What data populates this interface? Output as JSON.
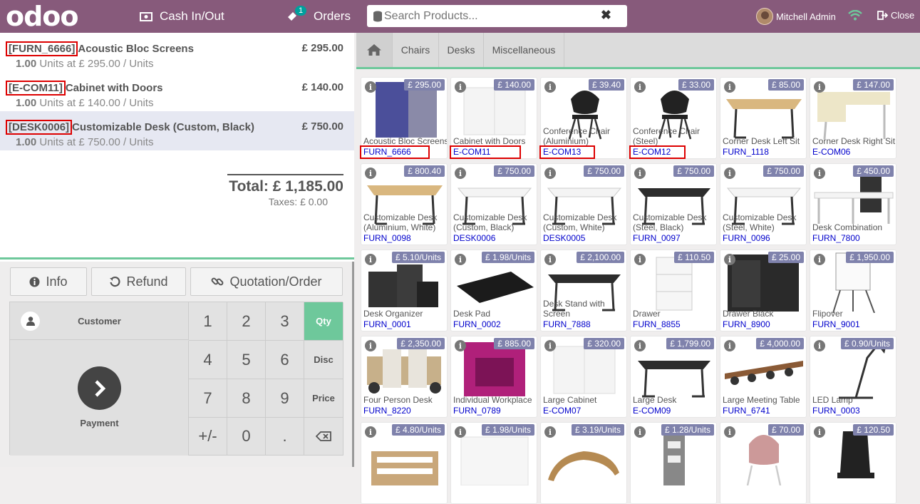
{
  "header": {
    "logo": "odoo",
    "cash_label": "Cash In/Out",
    "orders_label": "Orders",
    "orders_badge": "1",
    "search_placeholder": "Search Products...",
    "user_name": "Mitchell Admin",
    "close_label": "Close"
  },
  "order": {
    "lines": [
      {
        "code": "[FURN_6666]",
        "name": "Acoustic Bloc Screens",
        "price": "£ 295.00",
        "qty": "1.00",
        "unit_info": "Units at £ 295.00 / Units"
      },
      {
        "code": "[E-COM11]",
        "name": "Cabinet with Doors",
        "price": "£ 140.00",
        "qty": "1.00",
        "unit_info": "Units at £ 140.00 / Units"
      },
      {
        "code": "[DESK0006]",
        "name": "Customizable Desk (Custom, Black)",
        "price": "£ 750.00",
        "qty": "1.00",
        "unit_info": "Units at £ 750.00 / Units"
      }
    ],
    "total": "Total: £ 1,185.00",
    "taxes": "Taxes: £ 0.00"
  },
  "controls": {
    "info": "Info",
    "refund": "Refund",
    "quotation": "Quotation/Order",
    "customer": "Customer",
    "payment": "Payment",
    "keys": [
      "1",
      "2",
      "3",
      "4",
      "5",
      "6",
      "7",
      "8",
      "9",
      "+/-",
      "0",
      "."
    ],
    "modes": [
      "Qty",
      "Disc",
      "Price"
    ]
  },
  "categories": [
    "Chairs",
    "Desks",
    "Miscellaneous"
  ],
  "products": [
    {
      "name": "Acoustic Bloc Screens",
      "code": "FURN_6666",
      "price": "£ 295.00",
      "icon": "screen"
    },
    {
      "name": "Cabinet with Doors",
      "code": "E-COM11",
      "price": "£ 140.00",
      "icon": "cabinet"
    },
    {
      "name": "Conference Chair (Aluminium)",
      "code": "E-COM13",
      "price": "£ 39.40",
      "icon": "chair"
    },
    {
      "name": "Conference Chair (Steel)",
      "code": "E-COM12",
      "price": "£ 33.00",
      "icon": "chair"
    },
    {
      "name": "Corner Desk Left Sit",
      "code": "FURN_1118",
      "price": "£ 85.00",
      "icon": "desk-wood"
    },
    {
      "name": "Corner Desk Right Sit",
      "code": "E-COM06",
      "price": "£ 147.00",
      "icon": "desk-corner"
    },
    {
      "name": "Customizable Desk (Aluminium, White)",
      "code": "FURN_0098",
      "price": "£ 800.40",
      "icon": "desk-wood"
    },
    {
      "name": "Customizable Desk (Custom, Black)",
      "code": "DESK0006",
      "price": "£ 750.00",
      "icon": "desk-white"
    },
    {
      "name": "Customizable Desk (Custom, White)",
      "code": "DESK0005",
      "price": "£ 750.00",
      "icon": "desk-white"
    },
    {
      "name": "Customizable Desk (Steel, Black)",
      "code": "FURN_0097",
      "price": "£ 750.00",
      "icon": "desk-black"
    },
    {
      "name": "Customizable Desk (Steel, White)",
      "code": "FURN_0096",
      "price": "£ 750.00",
      "icon": "desk-white"
    },
    {
      "name": "Desk Combination",
      "code": "FURN_7800",
      "price": "£ 450.00",
      "icon": "desk-combo"
    },
    {
      "name": "Desk Organizer",
      "code": "FURN_0001",
      "price": "£ 5.10/Units",
      "icon": "organizer"
    },
    {
      "name": "Desk Pad",
      "code": "FURN_0002",
      "price": "£ 1.98/Units",
      "icon": "pad"
    },
    {
      "name": "Desk Stand with Screen",
      "code": "FURN_7888",
      "price": "£ 2,100.00",
      "icon": "desk-black"
    },
    {
      "name": "Drawer",
      "code": "FURN_8855",
      "price": "£ 110.50",
      "icon": "drawer"
    },
    {
      "name": "Drawer Black",
      "code": "FURN_8900",
      "price": "£ 25.00",
      "icon": "drawer-black"
    },
    {
      "name": "Flipover",
      "code": "FURN_9001",
      "price": "£ 1,950.00",
      "icon": "flipover"
    },
    {
      "name": "Four Person Desk",
      "code": "FURN_8220",
      "price": "£ 2,350.00",
      "icon": "office"
    },
    {
      "name": "Individual Workplace",
      "code": "FURN_0789",
      "price": "£ 885.00",
      "icon": "pod"
    },
    {
      "name": "Large Cabinet",
      "code": "E-COM07",
      "price": "£ 320.00",
      "icon": "cabinet"
    },
    {
      "name": "Large Desk",
      "code": "E-COM09",
      "price": "£ 1,799.00",
      "icon": "desk-black"
    },
    {
      "name": "Large Meeting Table",
      "code": "FURN_6741",
      "price": "£ 4,000.00",
      "icon": "meeting"
    },
    {
      "name": "LED Lamp",
      "code": "FURN_0003",
      "price": "£ 0.90/Units",
      "icon": "lamp"
    },
    {
      "name": "",
      "code": "",
      "price": "£ 4.80/Units",
      "icon": "tray"
    },
    {
      "name": "",
      "code": "",
      "price": "£ 1.98/Units",
      "icon": "paper"
    },
    {
      "name": "",
      "code": "",
      "price": "£ 3.19/Units",
      "icon": "stand"
    },
    {
      "name": "",
      "code": "",
      "price": "£ 1.28/Units",
      "icon": "holder"
    },
    {
      "name": "",
      "code": "",
      "price": "£ 70.00",
      "icon": "pink-chair"
    },
    {
      "name": "",
      "code": "",
      "price": "£ 120.50",
      "icon": "office-chair"
    }
  ],
  "colors": {
    "brand": "#875a7b",
    "accent": "#6ec89b",
    "price_tag": "#7f82ac",
    "code": "#0000cc"
  }
}
